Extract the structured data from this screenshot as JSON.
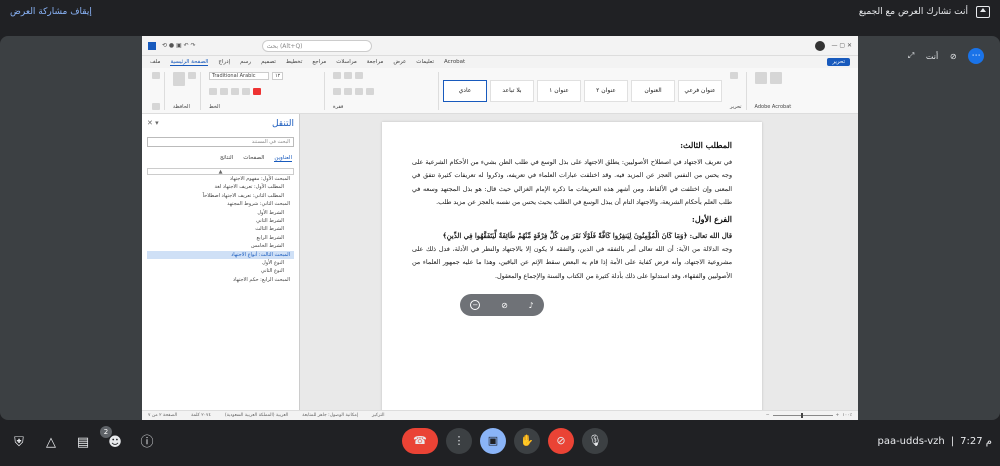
{
  "topbar": {
    "stop_sharing": "إيقاف مشاركة العرض",
    "sharing_notice": "أنت تشارك العرض مع الجميع",
    "share_icon": "present-screen-icon"
  },
  "floating": {
    "you_label": "أنت",
    "icons": [
      "more-icon",
      "mic-off-icon",
      "camera-off-icon",
      "expand-icon"
    ]
  },
  "word": {
    "search_placeholder": "بحث (Alt+Q)",
    "tabs": [
      "ملف",
      "الصفحة الرئيسية",
      "إدراج",
      "رسم",
      "تصميم",
      "تخطيط",
      "مراجع",
      "مراسلات",
      "مراجعة",
      "عرض",
      "تعليمات",
      "Acrobat"
    ],
    "selected_tab": "الصفحة الرئيسية",
    "edit_button": "تحرير",
    "font_name": "Traditional Arabic",
    "font_size": "١٢",
    "styles": [
      "عادي",
      "بلا تباعد",
      "عنوان ١",
      "عنوان ٢",
      "العنوان",
      "عنوان فرعي"
    ],
    "selected_style": "عادي",
    "ribbon_groups": [
      "الحافظة",
      "الخط",
      "فقرة",
      "أنماط",
      "تحرير",
      "Adobe Acrobat"
    ],
    "nav": {
      "title": "التنقل",
      "search": "البحث في المستند",
      "tabs": [
        "العناوين",
        "الصفحات",
        "النتائج"
      ],
      "selected_tab": "العناوين",
      "items": [
        {
          "label": "المبحث الأول: مفهوم الاجتهاد",
          "level": 0
        },
        {
          "label": "المطلب الأول: تعريف الاجتهاد لغة",
          "level": 1
        },
        {
          "label": "المطلب الثاني: تعريف الاجتهاد اصطلاحاً",
          "level": 1
        },
        {
          "label": "المبحث الثاني: شروط المجتهد",
          "level": 0
        },
        {
          "label": "الشرط الأول",
          "level": 1
        },
        {
          "label": "الشرط الثاني",
          "level": 1
        },
        {
          "label": "الشرط الثالث",
          "level": 1
        },
        {
          "label": "الشرط الرابع",
          "level": 1
        },
        {
          "label": "الشرط الخامس",
          "level": 1
        },
        {
          "label": "المبحث الثالث: أنواع الاجتهاد",
          "level": 0,
          "selected": true
        },
        {
          "label": "النوع الأول",
          "level": 1
        },
        {
          "label": "النوع الثاني",
          "level": 1
        },
        {
          "label": "المبحث الرابع: حكم الاجتهاد",
          "level": 0
        }
      ]
    },
    "doc": {
      "heading1": "المطلب الثالث:",
      "para1": "في تعريف الاجتهاد في اصطلاح الأصوليين: يطلق الاجتهاد على بذل الوسع في طلب الظن بشيء من الأحكام الشرعية على وجه يحس من النفس العجز عن المزيد فيه. وقد اختلفت عبارات العلماء في تعريفه، وذكروا له تعريفات كثيرة تتفق في المعنى وإن اختلفت في الألفاظ، ومن أشهر هذه التعريفات ما ذكره الإمام الغزالي حيث قال: هو بذل المجتهد وسعه في طلب العلم بأحكام الشريعة، والاجتهاد التام أن يبذل الوسع في الطلب بحيث يحس من نفسه بالعجز عن مزيد طلب.",
      "heading2": "الفرع الأول:",
      "para2": "قال الله تعالى: ﴿وَمَا كَانَ الْمُؤْمِنُونَ لِيَنفِرُوا كَافَّةً فَلَوْلَا نَفَرَ مِن كُلِّ فِرْقَةٍ مِّنْهُمْ طَائِفَةٌ لِّيَتَفَقَّهُوا فِي الدِّينِ﴾",
      "para3": "وجه الدلالة من الآية: أن الله تعالى أمر بالتفقه في الدين، والتفقه لا يكون إلا بالاجتهاد والنظر في الأدلة، فدل ذلك على مشروعية الاجتهاد، وأنه فرض كفاية على الأمة إذا قام به البعض سقط الإثم عن الباقين، وهذا ما عليه جمهور العلماء من الأصوليين والفقهاء، وقد استدلوا على ذلك بأدلة كثيرة من الكتاب والسنة والإجماع والمعقول."
    },
    "status": [
      "الصفحة ٢ من ٧",
      "٢٠٧٤ كلمة",
      "العربية (المملكة العربية السعودية)",
      "إمكانية الوصول: جاهز للمتابعة",
      "التركيز",
      "١٠٠٪"
    ]
  },
  "meeting": {
    "time": "7:27 م",
    "code": "paa-udds-vzh",
    "people_count": "2",
    "left_icons": [
      "info-icon",
      "people-icon",
      "chat-icon",
      "activities-icon",
      "host-controls-icon"
    ],
    "center_icons": [
      "mic-icon",
      "camera-off-icon",
      "raise-hand-icon",
      "present-icon",
      "more-options-icon",
      "end-call-icon"
    ]
  }
}
